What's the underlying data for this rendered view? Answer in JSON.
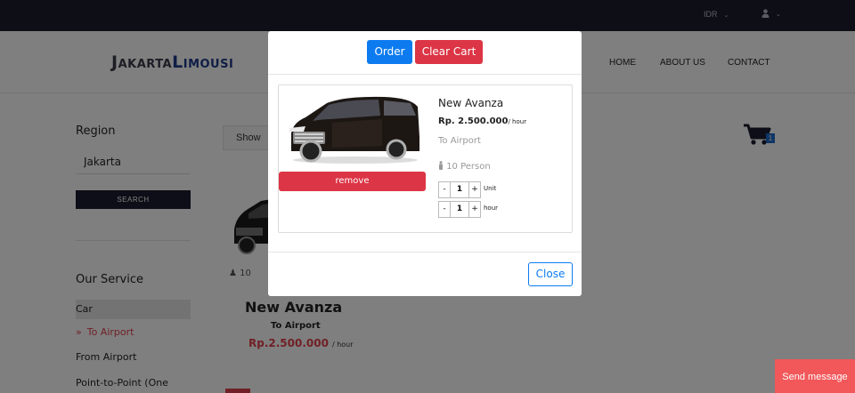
{
  "topbar": {
    "currency": "IDR"
  },
  "header": {
    "logo_part1": "Jakarta",
    "logo_part2": "Limousi",
    "nav": [
      "HOME",
      "ABOUT US",
      "CONTACT"
    ]
  },
  "sidebar": {
    "region_title": "Region",
    "region_value": "Jakarta",
    "search_label": "SEARCH",
    "service_title": "Our Service",
    "services": [
      "Car",
      "To Airport",
      "From Airport",
      "Point-to-Point (One Way)"
    ],
    "active_service": "Car",
    "selected_service": "To Airport",
    "selected_marker": "»"
  },
  "main": {
    "show_label": "Show",
    "cart_count": "1",
    "person_count": "10",
    "product_title": "New Avanza",
    "product_sub": "To Airport",
    "product_price": "Rp.2.500.000",
    "product_unit": "/ hour"
  },
  "modal": {
    "order_label": "Order",
    "clear_label": "Clear Cart",
    "item": {
      "name": "New Avanza",
      "price": "Rp. 2.500.000",
      "price_unit": "/ hour",
      "sub": "To Airport",
      "persons": "10 Person",
      "remove_label": "remove",
      "unit_qty": "1",
      "unit_label": "Unit",
      "hour_qty": "1",
      "hour_label": "hour",
      "minus": "-",
      "plus": "+"
    },
    "close_label": "Close"
  },
  "chat": {
    "label": "Send message"
  },
  "colors": {
    "primary": "#0d7bf0",
    "danger": "#dc3545",
    "dark": "#1c1d2e",
    "accent_red": "#e0404d"
  },
  "icons": {
    "cart": "cart-icon",
    "user": "user-icon",
    "person": "person-icon",
    "chevron": "chevron-down-icon"
  }
}
